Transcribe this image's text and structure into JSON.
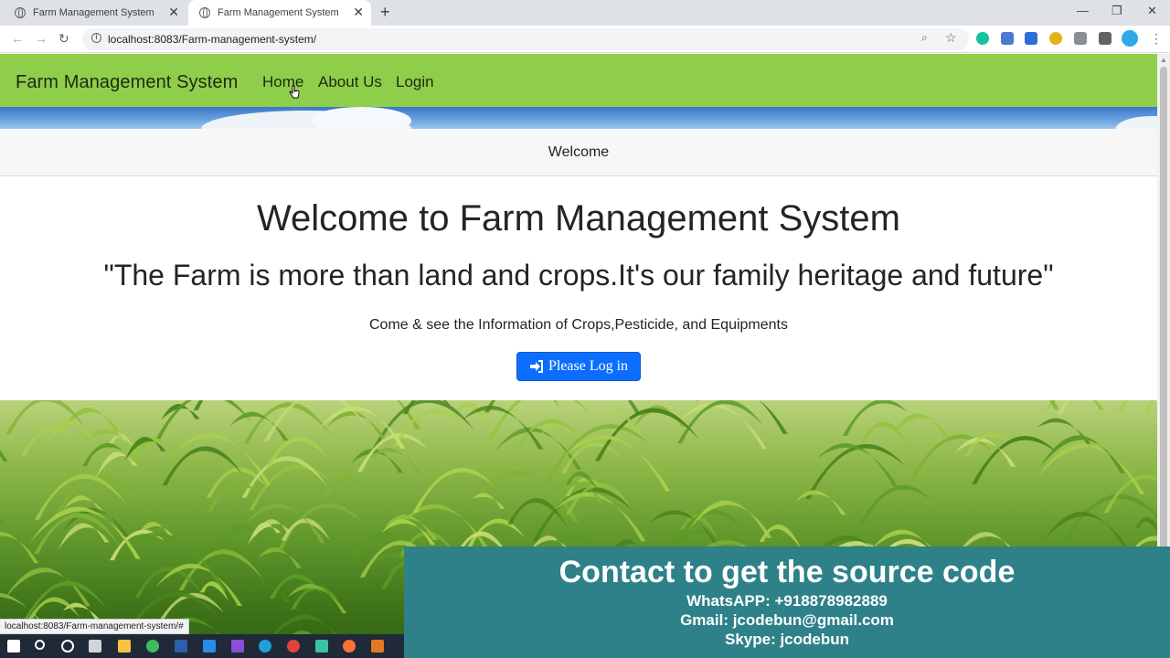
{
  "browser": {
    "tabs": [
      {
        "title": "Farm Management System",
        "active": false
      },
      {
        "title": "Farm Management System",
        "active": true
      }
    ],
    "url": "localhost:8083/Farm-management-system/",
    "status_url": "localhost:8083/Farm-management-system/#"
  },
  "navbar": {
    "brand": "Farm Management System",
    "links": [
      "Home",
      "About Us",
      "Login"
    ],
    "color": "#8fce4b"
  },
  "welcome_header": "Welcome",
  "hero": {
    "title": "Welcome to Farm Management System",
    "quote": "\"The Farm is more than land and crops.It's our family heritage and future\"",
    "subtitle": "Come & see the Information of Crops,Pesticide, and Equipments",
    "button_label": "Please Log in",
    "button_color": "#0d6efd"
  },
  "contact": {
    "title": "Contact to get the source code",
    "whatsapp": "WhatsAPP: +918878982889",
    "gmail": "Gmail: jcodebun@gmail.com",
    "skype": "Skype: jcodebun",
    "color": "#2e8189"
  }
}
